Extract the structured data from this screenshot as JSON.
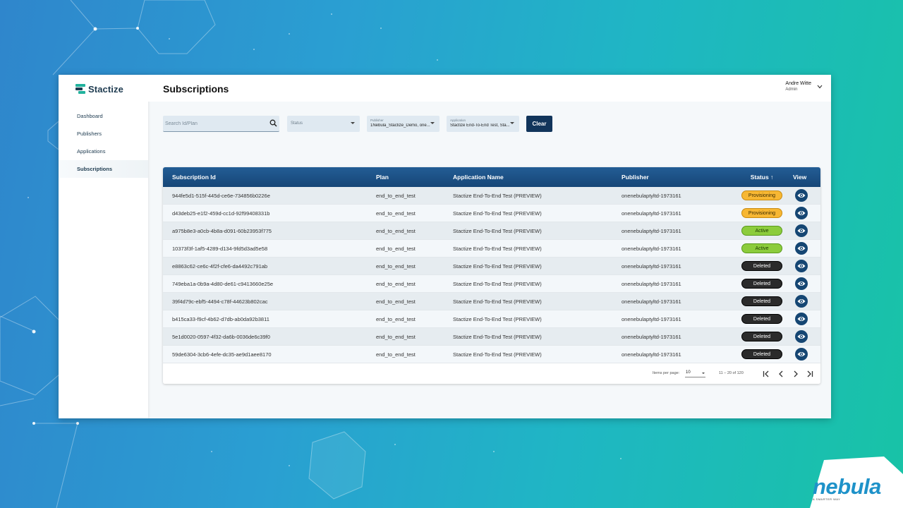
{
  "brand": {
    "name": "Stactize"
  },
  "sidebar": {
    "items": [
      {
        "label": "Dashboard"
      },
      {
        "label": "Publishers"
      },
      {
        "label": "Applications"
      },
      {
        "label": "Subscriptions",
        "active": true
      }
    ]
  },
  "header": {
    "title": "Subscriptions"
  },
  "user": {
    "name": "Andre Witte",
    "role": "Admin"
  },
  "filters": {
    "search_placeholder": "Search Id/Plan",
    "status_label": "Status",
    "publisher_label": "Publisher",
    "publisher_value": "1Nebula_Stactize_Demo, one...",
    "application_label": "Application",
    "application_value": "Stactize End-To-End Test, Sta...",
    "clear_label": "Clear"
  },
  "table": {
    "columns": [
      "Subscription Id",
      "Plan",
      "Application Name",
      "Publisher",
      "Status ↑",
      "View"
    ],
    "rows": [
      {
        "id": "944fe5d1-515f-445d-ce6e-734856b0226e",
        "plan": "end_to_end_test",
        "app": "Stactize End-To-End Test (PREVIEW)",
        "publisher": "onenebulaptyltd-1973161",
        "status": "Provisioning"
      },
      {
        "id": "d43deb25-e1f2-459d-cc1d-92f99408331b",
        "plan": "end_to_end_test",
        "app": "Stactize End-To-End Test (PREVIEW)",
        "publisher": "onenebulaptyltd-1973161",
        "status": "Provisioning"
      },
      {
        "id": "a975b8e3-a0cb-4b8a-d091-60b23953f775",
        "plan": "end_to_end_test",
        "app": "Stactize End-To-End Test (PREVIEW)",
        "publisher": "onenebulaptyltd-1973161",
        "status": "Active"
      },
      {
        "id": "10373f3f-1af5-4289-d134-9fd5d3ad5e58",
        "plan": "end_to_end_test",
        "app": "Stactize End-To-End Test (PREVIEW)",
        "publisher": "onenebulaptyltd-1973161",
        "status": "Active"
      },
      {
        "id": "e8863c62-ce6c-4f2f-cfe6-da4492c791ab",
        "plan": "end_to_end_test",
        "app": "Stactize End-To-End Test (PREVIEW)",
        "publisher": "onenebulaptyltd-1973161",
        "status": "Deleted"
      },
      {
        "id": "749eba1a-0b9a-4d80-de61-c9413660e25e",
        "plan": "end_to_end_test",
        "app": "Stactize End-To-End Test (PREVIEW)",
        "publisher": "onenebulaptyltd-1973161",
        "status": "Deleted"
      },
      {
        "id": "39f4d79c-ebf5-4494-c78f-44623b802cac",
        "plan": "end_to_end_test",
        "app": "Stactize End-To-End Test (PREVIEW)",
        "publisher": "onenebulaptyltd-1973161",
        "status": "Deleted"
      },
      {
        "id": "b415ca33-f9cf-4b62-d7db-ab0da92b3811",
        "plan": "end_to_end_test",
        "app": "Stactize End-To-End Test (PREVIEW)",
        "publisher": "onenebulaptyltd-1973161",
        "status": "Deleted"
      },
      {
        "id": "5e1d0020-0597-4f32-da6b-0036de6c39f0",
        "plan": "end_to_end_test",
        "app": "Stactize End-To-End Test (PREVIEW)",
        "publisher": "onenebulaptyltd-1973161",
        "status": "Deleted"
      },
      {
        "id": "59de6304-3cb6-4efe-dc35-ae9d1aee8170",
        "plan": "end_to_end_test",
        "app": "Stactize End-To-End Test (PREVIEW)",
        "publisher": "onenebulaptyltd-1973161",
        "status": "Deleted"
      }
    ]
  },
  "paginator": {
    "items_per_page_label": "Items per page:",
    "items_per_page_value": "10",
    "range_label": "11 – 20 of 120"
  },
  "corner_brand": {
    "name": "nebula",
    "tagline": "A SMARTER WAY"
  },
  "colors": {
    "header_blue": "#164677",
    "clear_button": "#12355b",
    "provisioning": "#f7b733",
    "active": "#8ccc3c",
    "deleted": "#2b2b2b"
  },
  "icons": {
    "search": "search-icon",
    "view": "eye-icon",
    "user_menu": "chevron-down-icon",
    "first": "first-page-icon",
    "prev": "chevron-left-icon",
    "next": "chevron-right-icon",
    "last": "last-page-icon"
  }
}
